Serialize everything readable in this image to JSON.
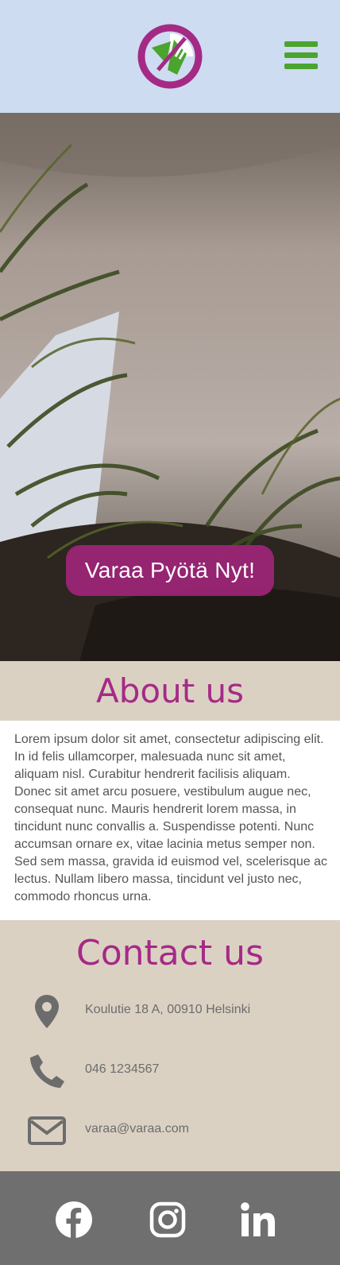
{
  "header": {
    "logo_icon": "plate-fork-knife-logo",
    "menu_icon": "hamburger-menu-icon",
    "colors": {
      "background": "#cddcf1",
      "logo_purple": "#a52a86",
      "green": "#4aa42e"
    }
  },
  "hero": {
    "image": "restaurant interior with palm plants",
    "cta_label": "Varaa Pyötä Nyt!"
  },
  "about": {
    "title": "About us",
    "body": "Lorem ipsum dolor sit amet, consectetur adipiscing elit. In id felis ullamcorper, malesuada nunc sit amet, aliquam nisl. Curabitur hendrerit facilisis aliquam. Donec sit amet arcu posuere, vestibulum augue nec, consequat nunc. Mauris hendrerit lorem massa, in tincidunt nunc convallis a. Suspendisse potenti. Nunc accumsan ornare ex, vitae lacinia metus semper non. Sed sem massa, gravida id euismod vel, scelerisque ac lectus. Nullam libero massa, tincidunt vel justo nec, commodo rhoncus urna."
  },
  "contact": {
    "title": "Contact us",
    "items": [
      {
        "icon": "location-pin-icon",
        "text": "Koulutie 18 A, 00910 Helsinki"
      },
      {
        "icon": "phone-icon",
        "text": "046 1234567"
      },
      {
        "icon": "envelope-icon",
        "text": "varaa@varaa.com"
      }
    ]
  },
  "footer": {
    "social": [
      {
        "icon": "facebook-icon"
      },
      {
        "icon": "instagram-icon"
      },
      {
        "icon": "linkedin-icon"
      }
    ],
    "colors": {
      "background": "#6f6f6f",
      "icon": "#ffffff"
    }
  }
}
